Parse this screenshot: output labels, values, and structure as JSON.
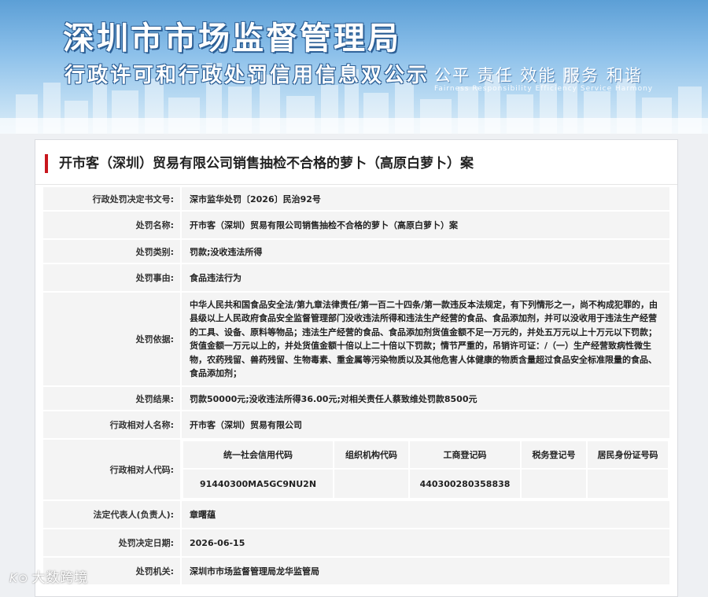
{
  "banner": {
    "title": "深圳市市场监督管理局",
    "subtitle": "行政许可和行政处罚信用信息双公示",
    "slogan": "公平 责任 效能 服务 和谐",
    "slogan_en": "Fairness Responsibility Efficiency Service Harmony"
  },
  "case": {
    "heading": "开市客（深圳）贸易有限公司销售抽检不合格的萝卜（高原白萝卜）案",
    "rows": {
      "doc_no": {
        "label": "行政处罚决定书文号:",
        "value": "深市监华处罚〔2026〕民治92号"
      },
      "name": {
        "label": "处罚名称:",
        "value": "开市客（深圳）贸易有限公司销售抽检不合格的萝卜（高原白萝卜）案"
      },
      "category": {
        "label": "处罚类别:",
        "value": "罚款;没收违法所得"
      },
      "reason": {
        "label": "处罚事由:",
        "value": "食品违法行为"
      },
      "basis": {
        "label": "处罚依据:",
        "value": "中华人民共和国食品安全法/第九章法律责任/第一百二十四条/第一款违反本法规定，有下列情形之一，尚不构成犯罪的，由县级以上人民政府食品安全监督管理部门没收违法所得和违法生产经营的食品、食品添加剂，并可以没收用于违法生产经营的工具、设备、原料等物品；违法生产经营的食品、食品添加剂货值金额不足一万元的，并处五万元以上十万元以下罚款；货值金额一万元以上的，并处货值金额十倍以上二十倍以下罚款；情节严重的，吊销许可证：/（一）生产经营致病性微生物，农药残留、兽药残留、生物毒素、重金属等污染物质以及其他危害人体健康的物质含量超过食品安全标准限量的食品、食品添加剂；"
      },
      "result": {
        "label": "处罚结果:",
        "value": "罚款50000元;没收违法所得36.00元;对相关责任人蔡致维处罚款8500元"
      },
      "party_name": {
        "label": "行政相对人名称:",
        "value": "开市客（深圳）贸易有限公司"
      },
      "party_code": {
        "label": "行政相对人代码:"
      },
      "legal_rep": {
        "label": "法定代表人(负责人):",
        "value": "章曙蕴"
      },
      "decision_date": {
        "label": "处罚决定日期:",
        "value": "2026-06-15"
      },
      "authority": {
        "label": "处罚机关:",
        "value": "深圳市市场监督管理局龙华监管局"
      }
    },
    "codes": {
      "headers": {
        "credit_code": "统一社会信用代码",
        "org_code": "组织机构代码",
        "business_reg": "工商登记码",
        "tax_reg": "税务登记号",
        "id_no": "居民身份证号码"
      },
      "values": {
        "credit_code": "91440300MA5GC9NU2N",
        "org_code": "",
        "business_reg": "440300280358838",
        "tax_reg": "",
        "id_no": ""
      }
    }
  },
  "watermark": {
    "logo": "K⊙",
    "text": "大数跨境"
  },
  "colors": {
    "accent": "#c8161d",
    "label_bg": "#f4f4f4",
    "banner_blue": "#5c9fd6"
  }
}
